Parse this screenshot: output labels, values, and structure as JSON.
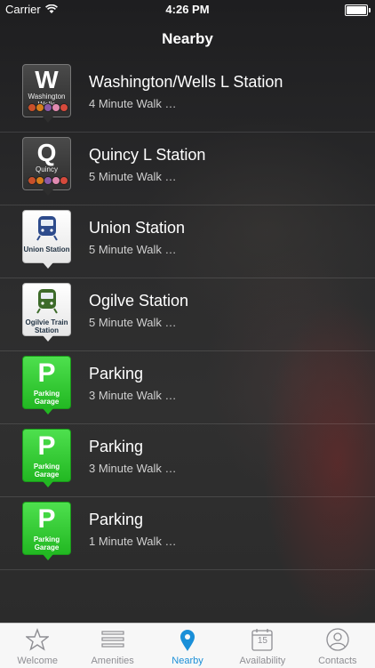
{
  "status_bar": {
    "carrier": "Carrier",
    "time": "4:26 PM"
  },
  "nav": {
    "title": "Nearby"
  },
  "rows": [
    {
      "title": "Washington/Wells L Station",
      "subtitle": "4 Minute Walk …",
      "icon": {
        "style": "dark",
        "letter": "W",
        "caption": "Washington Wells",
        "line_colors": [
          "#c8502a",
          "#d67d1c",
          "#8a5aa8",
          "#e08ab0",
          "#d64a3c"
        ]
      }
    },
    {
      "title": "Quincy L Station",
      "subtitle": "5 Minute Walk …",
      "icon": {
        "style": "dark",
        "letter": "Q",
        "caption": "Quincy",
        "line_colors": [
          "#c8502a",
          "#d67d1c",
          "#8a5aa8",
          "#e08ab0",
          "#d64a3c"
        ]
      }
    },
    {
      "title": "Union Station",
      "subtitle": "5 Minute Walk …",
      "icon": {
        "style": "white",
        "caption": "Union Station",
        "train_color": "#2d4b8c"
      }
    },
    {
      "title": "Ogilve Station",
      "subtitle": "5 Minute Walk …",
      "icon": {
        "style": "white",
        "caption": "Ogilvie Train Station",
        "train_color": "#3d6b2a"
      }
    },
    {
      "title": "Parking",
      "subtitle": "3 Minute Walk …",
      "icon": {
        "style": "green",
        "letter": "P",
        "caption": "Parking Garage"
      }
    },
    {
      "title": "Parking",
      "subtitle": "3 Minute Walk …",
      "icon": {
        "style": "green",
        "letter": "P",
        "caption": "Parking Garage"
      }
    },
    {
      "title": "Parking",
      "subtitle": "1 Minute Walk …",
      "icon": {
        "style": "green",
        "letter": "P",
        "caption": "Parking Garage"
      }
    }
  ],
  "tab_bar": {
    "tabs": [
      {
        "label": "Welcome",
        "icon": "star-icon",
        "active": false
      },
      {
        "label": "Amenities",
        "icon": "list-icon",
        "active": false
      },
      {
        "label": "Nearby",
        "icon": "map-pin-icon",
        "active": true
      },
      {
        "label": "Availability",
        "icon": "calendar-icon",
        "active": false,
        "badge": "15"
      },
      {
        "label": "Contacts",
        "icon": "contact-icon",
        "active": false
      }
    ]
  },
  "colors": {
    "active_tab": "#1a8fd8",
    "inactive_tab": "#8e8e93",
    "parking_green": "#2ecc2e"
  }
}
